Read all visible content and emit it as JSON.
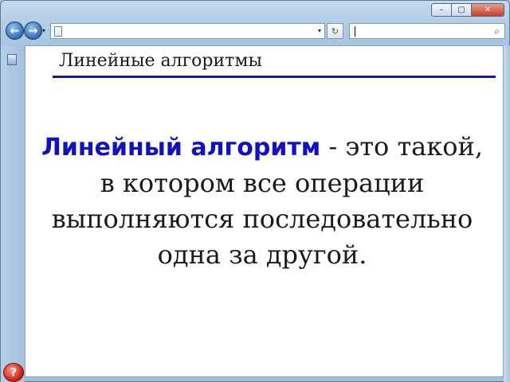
{
  "window": {
    "minimize_glyph": "–",
    "maximize_glyph": "▢",
    "close_glyph": "✕"
  },
  "navbar": {
    "back_glyph": "←",
    "forward_glyph": "→",
    "dropdown_glyph": "▾",
    "address_value": "",
    "refresh_glyph": "↻",
    "search_value": "",
    "search_glyph": "⌕"
  },
  "gutter": {
    "help_glyph": "?"
  },
  "slide": {
    "title": "Линейные алгоритмы",
    "definition_term": "Линейный алгоритм",
    "definition_rest": " - это такой, в котором все операции выполняются последовательно одна за другой."
  },
  "colors": {
    "term": "#1010c8",
    "title_rule": "#1a1a8f",
    "close_button": "#c8402a"
  },
  "icons": [
    "back-arrow-icon",
    "forward-arrow-icon",
    "page-icon",
    "refresh-icon",
    "search-icon",
    "favorites-icon",
    "help-icon"
  ]
}
